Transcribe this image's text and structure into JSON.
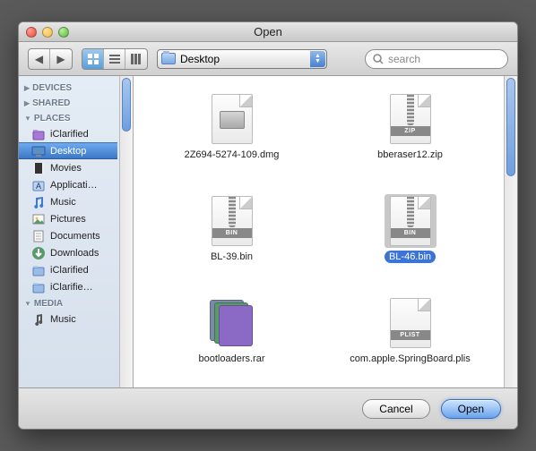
{
  "window": {
    "title": "Open"
  },
  "toolbar": {
    "location": "Desktop",
    "search_placeholder": "search"
  },
  "sidebar": {
    "groups": [
      {
        "label": "DEVICES",
        "expanded": false,
        "items": []
      },
      {
        "label": "SHARED",
        "expanded": false,
        "items": []
      },
      {
        "label": "PLACES",
        "expanded": true,
        "items": [
          {
            "label": "iClarified",
            "icon": "folder-purple",
            "selected": false
          },
          {
            "label": "Desktop",
            "icon": "desktop",
            "selected": true
          },
          {
            "label": "Movies",
            "icon": "movies",
            "selected": false
          },
          {
            "label": "Applicati…",
            "icon": "applications",
            "selected": false
          },
          {
            "label": "Music",
            "icon": "music",
            "selected": false
          },
          {
            "label": "Pictures",
            "icon": "pictures",
            "selected": false
          },
          {
            "label": "Documents",
            "icon": "documents",
            "selected": false
          },
          {
            "label": "Downloads",
            "icon": "downloads",
            "selected": false
          },
          {
            "label": "iClarified",
            "icon": "folder",
            "selected": false
          },
          {
            "label": "iClarifie…",
            "icon": "folder",
            "selected": false
          }
        ]
      },
      {
        "label": "MEDIA",
        "expanded": true,
        "items": [
          {
            "label": "Music",
            "icon": "music-note",
            "selected": false
          }
        ]
      }
    ]
  },
  "files": [
    {
      "name": "2Z694-5274-109.dmg",
      "kind": "dmg",
      "band": "",
      "selected": false
    },
    {
      "name": "bberaser12.zip",
      "kind": "zip",
      "band": "ZIP",
      "selected": false
    },
    {
      "name": "BL-39.bin",
      "kind": "bin",
      "band": "BIN",
      "selected": false
    },
    {
      "name": "BL-46.bin",
      "kind": "bin",
      "band": "BIN",
      "selected": true
    },
    {
      "name": "bootloaders.rar",
      "kind": "rar",
      "band": "",
      "selected": false
    },
    {
      "name": "com.apple.SpringBoard.plis",
      "kind": "plist",
      "band": "PLIST",
      "selected": false
    }
  ],
  "buttons": {
    "cancel": "Cancel",
    "open": "Open"
  }
}
